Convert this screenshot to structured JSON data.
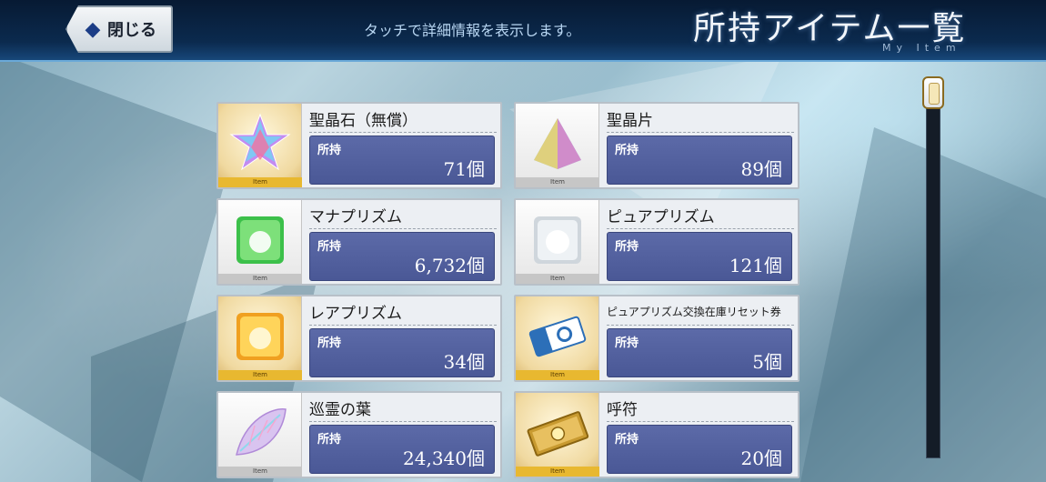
{
  "header": {
    "close_label": "閉じる",
    "hint": "タッチで詳細情報を表示します。",
    "title": "所持アイテム一覧",
    "subtitle": "My Item"
  },
  "items": [
    {
      "name": "聖晶石（無償）",
      "count_label": "所持",
      "count": "71個",
      "tag": "Item",
      "icon": "saint-quartz-icon"
    },
    {
      "name": "聖晶片",
      "count_label": "所持",
      "count": "89個",
      "tag": "Item",
      "icon": "quartz-fragment-icon"
    },
    {
      "name": "マナプリズム",
      "count_label": "所持",
      "count": "6,732個",
      "tag": "Item",
      "icon": "mana-prism-icon"
    },
    {
      "name": "ピュアプリズム",
      "count_label": "所持",
      "count": "121個",
      "tag": "Item",
      "icon": "pure-prism-icon"
    },
    {
      "name": "レアプリズム",
      "count_label": "所持",
      "count": "34個",
      "tag": "Item",
      "icon": "rare-prism-icon"
    },
    {
      "name": "ピュアプリズム交換在庫リセット券",
      "count_label": "所持",
      "count": "5個",
      "tag": "Item",
      "icon": "reset-ticket-icon"
    },
    {
      "name": "巡霊の葉",
      "count_label": "所持",
      "count": "24,340個",
      "tag": "Item",
      "icon": "spirit-leaf-icon"
    },
    {
      "name": "呼符",
      "count_label": "所持",
      "count": "20個",
      "tag": "Item",
      "icon": "summon-ticket-icon"
    }
  ]
}
